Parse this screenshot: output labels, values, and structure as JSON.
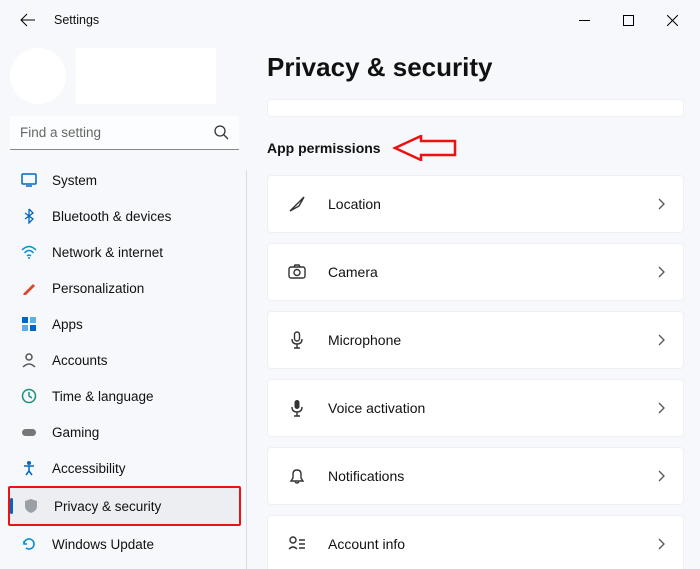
{
  "window": {
    "title": "Settings"
  },
  "search": {
    "placeholder": "Find a setting"
  },
  "sidebar": {
    "items": [
      {
        "label": "System"
      },
      {
        "label": "Bluetooth & devices"
      },
      {
        "label": "Network & internet"
      },
      {
        "label": "Personalization"
      },
      {
        "label": "Apps"
      },
      {
        "label": "Accounts"
      },
      {
        "label": "Time & language"
      },
      {
        "label": "Gaming"
      },
      {
        "label": "Accessibility"
      },
      {
        "label": "Privacy & security"
      },
      {
        "label": "Windows Update"
      }
    ]
  },
  "page": {
    "title": "Privacy & security",
    "section_label": "App permissions",
    "items": [
      {
        "label": "Location"
      },
      {
        "label": "Camera"
      },
      {
        "label": "Microphone"
      },
      {
        "label": "Voice activation"
      },
      {
        "label": "Notifications"
      },
      {
        "label": "Account info"
      }
    ]
  }
}
